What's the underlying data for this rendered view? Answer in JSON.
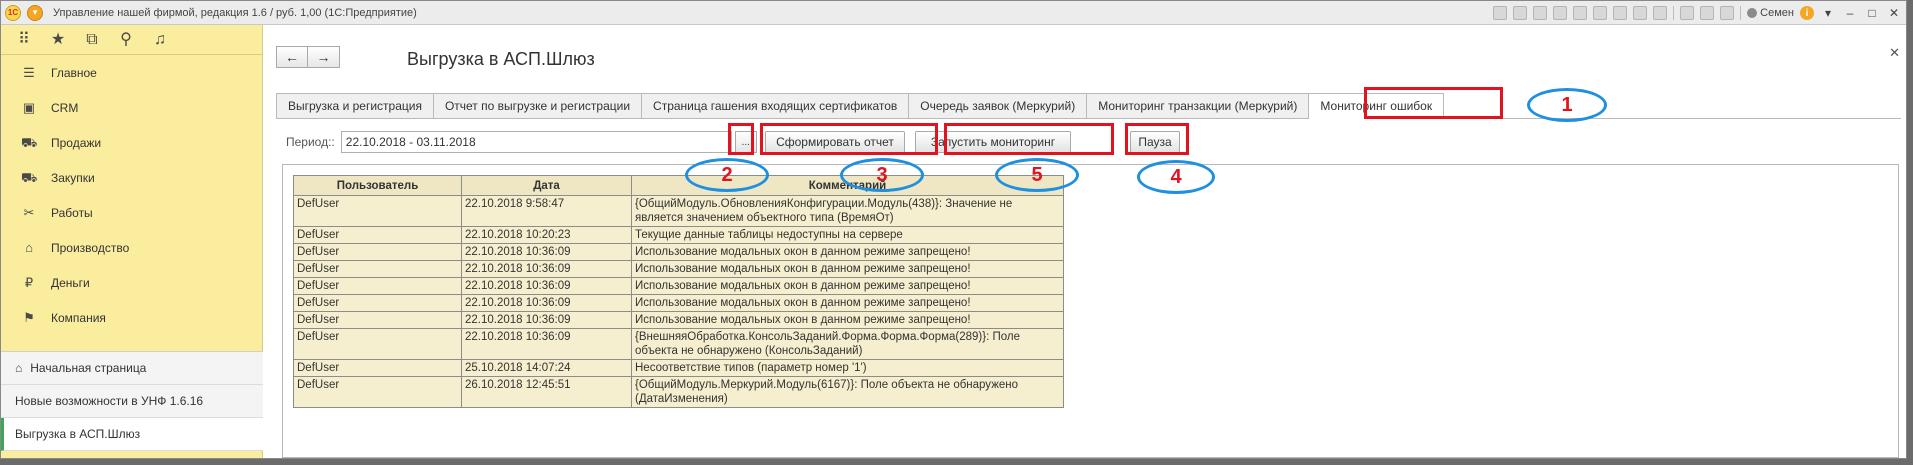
{
  "app_title": "Управление нашей фирмой, редакция 1.6 / руб. 1,00 (1С:Предприятие)",
  "logo_text": "1С",
  "user_name": "Семен",
  "sidebar": {
    "sections": [
      {
        "label": "Главное",
        "icon": "menu-icon"
      },
      {
        "label": "CRM",
        "icon": "contact-card-icon"
      },
      {
        "label": "Продажи",
        "icon": "cart-icon"
      },
      {
        "label": "Закупки",
        "icon": "truck-icon"
      },
      {
        "label": "Работы",
        "icon": "tools-icon"
      },
      {
        "label": "Производство",
        "icon": "factory-icon"
      },
      {
        "label": "Деньги",
        "icon": "coin-icon"
      },
      {
        "label": "Компания",
        "icon": "flag-icon"
      }
    ],
    "nav": [
      {
        "label": "Начальная страница"
      },
      {
        "label": "Новые возможности в УНФ 1.6.16"
      },
      {
        "label": "Выгрузка в АСП.Шлюз"
      }
    ]
  },
  "form": {
    "title": "Выгрузка в АСП.Шлюз",
    "tabs": [
      {
        "label": "Выгрузка и регистрация"
      },
      {
        "label": "Отчет по выгрузке и регистрации"
      },
      {
        "label": "Страница гашения входящих сертификатов"
      },
      {
        "label": "Очередь заявок (Меркурий)"
      },
      {
        "label": "Мониторинг транзакции (Меркурий)"
      },
      {
        "label": "Мониторинг ошибок"
      }
    ],
    "period_label": "Период::",
    "period_value": "22.10.2018 - 03.11.2018",
    "dots_label": "...",
    "btn_report": "Сформировать отчет",
    "btn_monitor": "Запустить мониторинг",
    "btn_pause": "Пауза"
  },
  "table": {
    "headers": [
      "Пользователь",
      "Дата",
      "Комментарий"
    ],
    "rows": [
      [
        "DefUser",
        "22.10.2018 9:58:47",
        "{ОбщийМодуль.ОбновленияКонфигурации.Модуль(438)}: Значение не является значением объектного типа (ВремяОт)"
      ],
      [
        "DefUser",
        "22.10.2018 10:20:23",
        "Текущие данные таблицы недоступны на сервере"
      ],
      [
        "DefUser",
        "22.10.2018 10:36:09",
        "Использование модальных окон в данном режиме запрещено!"
      ],
      [
        "DefUser",
        "22.10.2018 10:36:09",
        "Использование модальных окон в данном режиме запрещено!"
      ],
      [
        "DefUser",
        "22.10.2018 10:36:09",
        "Использование модальных окон в данном режиме запрещено!"
      ],
      [
        "DefUser",
        "22.10.2018 10:36:09",
        "Использование модальных окон в данном режиме запрещено!"
      ],
      [
        "DefUser",
        "22.10.2018 10:36:09",
        "Использование модальных окон в данном режиме запрещено!"
      ],
      [
        "DefUser",
        "22.10.2018 10:36:09",
        "{ВнешняяОбработка.КонсольЗаданий.Форма.Форма.Форма(289)}: Поле объекта не обнаружено (КонсольЗаданий)"
      ],
      [
        "DefUser",
        "25.10.2018 14:07:24",
        "Несоответствие типов (параметр номер '1')"
      ],
      [
        "DefUser",
        "26.10.2018 12:45:51",
        "{ОбщийМодуль.Меркурий.Модуль(6167)}: Поле объекта не обнаружено (ДатаИзменения)"
      ]
    ]
  },
  "annotations": [
    "1",
    "2",
    "3",
    "4",
    "5"
  ],
  "colors": {
    "sidebar": "#fbed9e",
    "highlight": "#e2131f",
    "oval": "#1f8fe0",
    "grid": "#f6efcf"
  }
}
